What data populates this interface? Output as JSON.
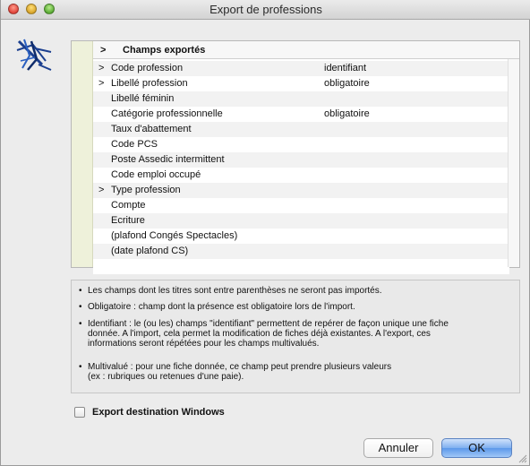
{
  "window": {
    "title": "Export de professions"
  },
  "fields": {
    "header_arrow": ">",
    "header_label": "Champs exportés",
    "rows": [
      {
        "marker": ">",
        "name": "Code profession",
        "status": "identifiant"
      },
      {
        "marker": ">",
        "name": "Libellé profession",
        "status": "obligatoire"
      },
      {
        "marker": "",
        "name": "Libellé féminin",
        "status": ""
      },
      {
        "marker": "",
        "name": "Catégorie professionnelle",
        "status": "obligatoire"
      },
      {
        "marker": "",
        "name": "Taux d'abattement",
        "status": ""
      },
      {
        "marker": "",
        "name": "Code PCS",
        "status": ""
      },
      {
        "marker": "",
        "name": "Poste Assedic intermittent",
        "status": ""
      },
      {
        "marker": "",
        "name": "Code emploi occupé",
        "status": ""
      },
      {
        "marker": ">",
        "name": "Type profession",
        "status": ""
      },
      {
        "marker": "",
        "name": "Compte",
        "status": ""
      },
      {
        "marker": "",
        "name": "Ecriture",
        "status": ""
      },
      {
        "marker": "",
        "name": "(plafond Congés Spectacles)",
        "status": ""
      },
      {
        "marker": "",
        "name": "(date plafond CS)",
        "status": ""
      },
      {
        "marker": "",
        "name": "",
        "status": ""
      }
    ]
  },
  "info": {
    "bullet": "•",
    "items": [
      "Les champs dont les titres sont entre parenthèses ne seront pas importés.",
      "Obligatoire : champ dont la présence est obligatoire lors de l'import.",
      "Identifiant : le (ou les) champs \"identifiant\" permettent de repérer de façon unique une fiche\ndonnée. A l'import, cela permet la modification de fiches déjà existantes. A l'export, ces\ninformations seront répétées pour les champs multivalués.",
      "Multivalué : pour une fiche donnée, ce champ peut prendre plusieurs valeurs\n(ex : rubriques ou retenues d'une paie)."
    ]
  },
  "options": {
    "export_windows_label": "Export destination Windows",
    "export_windows_checked": false
  },
  "buttons": {
    "cancel_label": "Annuler",
    "ok_label": "OK"
  },
  "colors": {
    "gutter": "#eef1da",
    "ok_button": "#5d98ea",
    "logo_blue": "#1b3f8f"
  }
}
